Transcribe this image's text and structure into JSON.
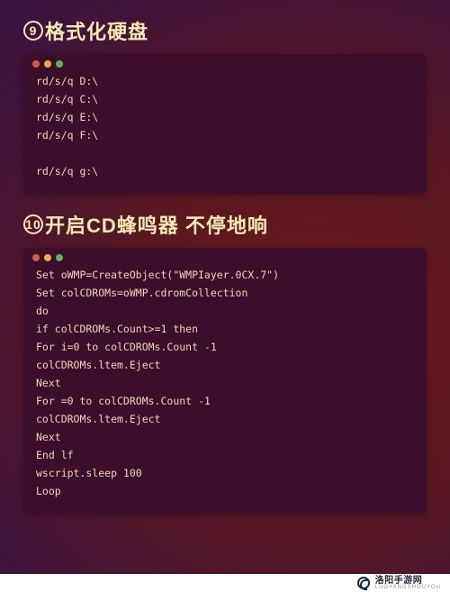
{
  "sections": [
    {
      "number": "9",
      "title": "格式化硬盘",
      "code": [
        "rd/s/q D:\\",
        "rd/s/q C:\\",
        "rd/s/q E:\\",
        "rd/s/q F:\\",
        "",
        "rd/s/q g:\\"
      ]
    },
    {
      "number": "10",
      "title": "开启CD蜂鸣器 不停地响",
      "code": [
        "Set oWMP=CreateObject(\"WMPIayer.0CX.7\")",
        "Set colCDROMs=oWMP.cdromCollection",
        "do",
        "if colCDROMs.Count>=1 then",
        "For i=0 to colCDROMs.Count -1",
        "colCDROMs.ltem.Eject",
        "Next",
        "For =0 to colCDROMs.Count -1",
        "colCDROMs.ltem.Eject",
        "Next",
        "End lf",
        "wscript.sleep 100",
        "Loop"
      ]
    }
  ],
  "footer": {
    "brand": "洛阳手游网",
    "sub": "LUOYANGSHOUYOU"
  }
}
